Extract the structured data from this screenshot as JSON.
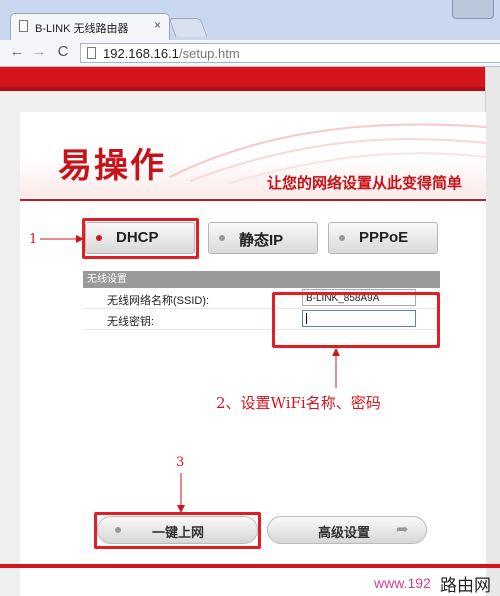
{
  "browser": {
    "tab_title": "B-LINK 无线路由器",
    "tab_close": "×",
    "url_host": "192.168.16.1",
    "url_path": "/setup.htm",
    "nav": {
      "back": "←",
      "forward": "→",
      "reload": "C"
    }
  },
  "banner": {
    "logo": "易操作",
    "slogan": "让您的网络设置从此变得简单"
  },
  "modes": {
    "dhcp": "DHCP",
    "static": "静态IP",
    "pppoe": "PPPoE"
  },
  "wireless": {
    "header": "无线设置",
    "ssid_label": "无线网络名称(SSID):",
    "ssid_value": "B-LINK_858A9A",
    "password_label": "无线密钥:",
    "password_value": ""
  },
  "annotations": {
    "a1": "1",
    "a2": "2、设置WiFi名称、密码",
    "a3": "3"
  },
  "actions": {
    "connect": "一键上网",
    "advanced": "高级设置",
    "advanced_arrow": "➦"
  },
  "watermark": {
    "url": "www.192",
    "cn": "路由网"
  },
  "colors": {
    "brand_red": "#d4151b",
    "highlight_red": "#e01e24",
    "watermark_pink": "#d33f8f"
  },
  "icons": [
    "page-icon",
    "back-arrow-icon",
    "forward-arrow-icon",
    "reload-icon",
    "radio-dot-icon",
    "arrow-right-icon"
  ]
}
